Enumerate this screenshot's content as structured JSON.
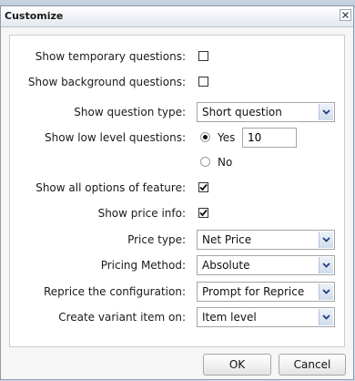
{
  "dialog": {
    "title": "Customize",
    "ok_label": "OK",
    "cancel_label": "Cancel"
  },
  "form": {
    "show_temporary_questions": {
      "label": "Show temporary questions:",
      "checked": false
    },
    "show_background_questions": {
      "label": "Show background questions:",
      "checked": false
    },
    "show_question_type": {
      "label": "Show question type:",
      "value": "Short question"
    },
    "show_low_level_questions": {
      "label": "Show low level questions:",
      "yes_label": "Yes",
      "no_label": "No",
      "selected": "Yes",
      "level_value": "10"
    },
    "show_all_options": {
      "label": "Show all options of feature:",
      "checked": true
    },
    "show_price_info": {
      "label": "Show price info:",
      "checked": true
    },
    "price_type": {
      "label": "Price type:",
      "value": "Net Price"
    },
    "pricing_method": {
      "label": "Pricing Method:",
      "value": "Absolute"
    },
    "reprice_configuration": {
      "label": "Reprice the configuration:",
      "value": "Prompt for Reprice"
    },
    "create_variant_item": {
      "label": "Create variant item on:",
      "value": "Item level"
    }
  },
  "icons": {
    "close": "close-icon",
    "dropdown": "chevron-down-icon",
    "check": "check-icon"
  },
  "colors": {
    "dialog_background": "#f6f6f6",
    "panel_background": "#ffffff",
    "dropdown_arrow_blue": "#1f3d7a"
  }
}
